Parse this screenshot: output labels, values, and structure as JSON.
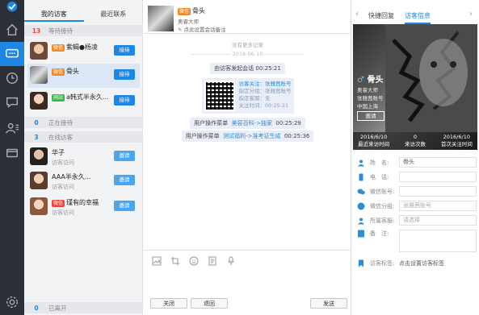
{
  "colors": {
    "accent": "#1e87e6",
    "nav_bg": "#2b2f36",
    "tag_orange": "#f08a24"
  },
  "list": {
    "tabs": [
      "我的访客",
      "最近联系"
    ],
    "waiting": {
      "count": "13",
      "label": "等待接待"
    },
    "waiting_items": [
      {
        "tag": "微信",
        "name": "紫蝎●杨凌",
        "btn": "接待"
      },
      {
        "tag": "微信",
        "name": "骨头",
        "btn": "接待"
      },
      {
        "tag": "网站",
        "name": "a韩式半永久...",
        "btn": "接待"
      }
    ],
    "serving": {
      "count": "0",
      "label": "正在接待"
    },
    "online": {
      "count": "3",
      "label": "在线访客"
    },
    "online_items": [
      {
        "name": "华子",
        "sub": "访客访问",
        "btn": "邀请"
      },
      {
        "name": "AAA半永久...",
        "sub": "访客访问",
        "btn": "邀请"
      },
      {
        "name": "瑾有的幸福",
        "sub": "访客访问",
        "btn": "邀请"
      }
    ],
    "left": {
      "count": "0",
      "label": "已离开"
    }
  },
  "chat": {
    "name": "骨头",
    "tag": "微信",
    "account": "奥睿大师",
    "remark": "点此设置会话备注",
    "no_more": "没有更多记录",
    "date": "2018-06-10",
    "start_msg": "由访客发起会话",
    "start_time": "00:25:21",
    "card": [
      "访客关注：张雅茜账号",
      "指定分组：张雅茜账号",
      "指定客服：无",
      "关注时间：00:25:21"
    ],
    "op1": {
      "label": "用户操作菜单",
      "link": "美容百科->独家",
      "time": "00:25:29"
    },
    "op2": {
      "label": "用户操作菜单",
      "link": "测试福利->准考证生成",
      "time": "00:25:36"
    },
    "close": "关闭",
    "back": "退回",
    "send": "发送"
  },
  "info": {
    "tabs": [
      "快捷回复",
      "访客信息"
    ],
    "name": "骨头",
    "line1": "奥睿大师",
    "line2": "张雅茜账号",
    "loc": "中国上海",
    "invite": "邀请",
    "stats": [
      {
        "value": "2016/6/10",
        "label": "最近来访时间"
      },
      {
        "value": "0",
        "label": "来访次数"
      },
      {
        "value": "2016/6/10",
        "label": "首次关注时间"
      }
    ],
    "fields": [
      {
        "label": "姓　名:",
        "value": "骨头",
        "icon": "user-icon"
      },
      {
        "label": "电　话:",
        "value": "",
        "icon": "phone-icon"
      },
      {
        "label": "微信账号:",
        "value": "",
        "icon": "wechat-icon"
      },
      {
        "label": "微信分组:",
        "value": "张雅茜账号",
        "icon": "group-icon"
      },
      {
        "label": "所属客服:",
        "value": "请选择",
        "icon": "service-icon"
      },
      {
        "label": "备　注:",
        "value": "",
        "icon": "note-icon"
      }
    ],
    "tag_label": "访客标签:",
    "tag_placeholder": "点击设置访客标签"
  }
}
